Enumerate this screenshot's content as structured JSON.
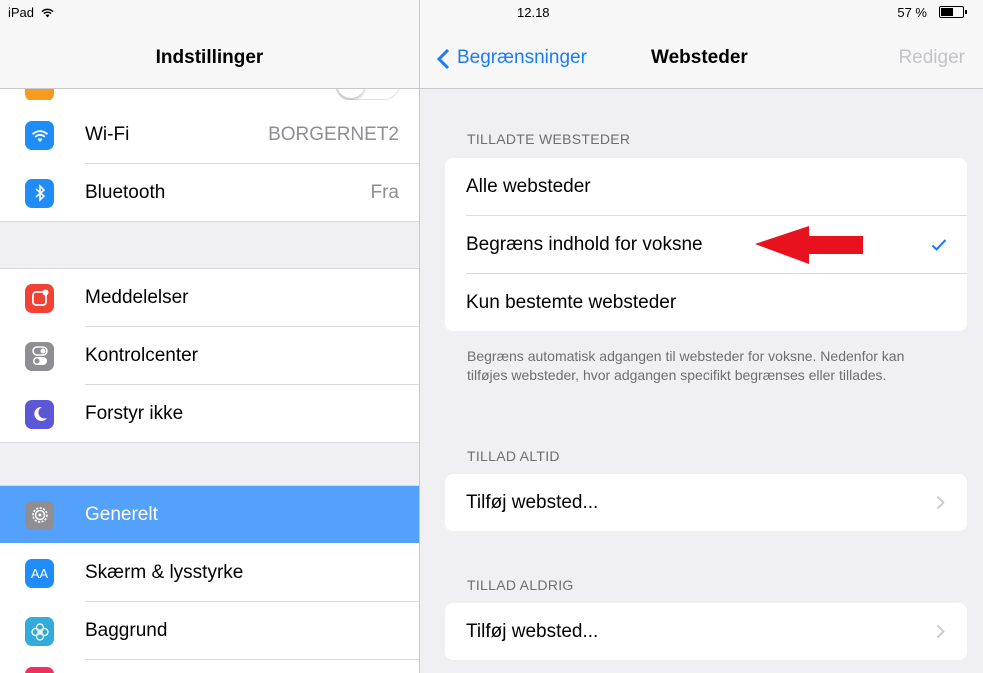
{
  "status_bar": {
    "device": "iPad",
    "time": "12.18",
    "battery": "57 %"
  },
  "sidebar": {
    "title": "Indstillinger",
    "items": [
      {
        "label": "Wi-Fi",
        "value": "BORGERNET2",
        "icon": "wifi-icon",
        "color": "#1f8cf8"
      },
      {
        "label": "Bluetooth",
        "value": "Fra",
        "icon": "bluetooth-icon",
        "color": "#1f8cf8"
      },
      {
        "label": "Meddelelser",
        "value": "",
        "icon": "notifications-icon",
        "color": "#f24236"
      },
      {
        "label": "Kontrolcenter",
        "value": "",
        "icon": "control-center-icon",
        "color": "#8e8e93"
      },
      {
        "label": "Forstyr ikke",
        "value": "",
        "icon": "moon-icon",
        "color": "#5b57d6"
      },
      {
        "label": "Generelt",
        "value": "",
        "icon": "gear-icon",
        "color": "#8e8e93",
        "selected": true
      },
      {
        "label": "Skærm & lysstyrke",
        "value": "",
        "icon": "display-icon",
        "color": "#1f8cf8"
      },
      {
        "label": "Baggrund",
        "value": "",
        "icon": "wallpaper-icon",
        "color": "#35aadc"
      }
    ]
  },
  "detail": {
    "back_label": "Begrænsninger",
    "title": "Websteder",
    "edit_label": "Rediger",
    "section_allowed": "TILLADTE WEBSTEDER",
    "options": [
      {
        "label": "Alle websteder",
        "checked": false
      },
      {
        "label": "Begræns indhold for voksne",
        "checked": true
      },
      {
        "label": "Kun bestemte websteder",
        "checked": false
      }
    ],
    "footer": "Begræns automatisk adgangen til websteder for voksne. Nedenfor kan tilføjes websteder, hvor adgangen specifikt begrænses eller tillades.",
    "section_always": "TILLAD ALTID",
    "add_always": "Tilføj websted...",
    "section_never": "TILLAD ALDRIG",
    "add_never": "Tilføj websted...",
    "accent_color": "#1a7cf5",
    "arrow_color": "#e8121f"
  }
}
